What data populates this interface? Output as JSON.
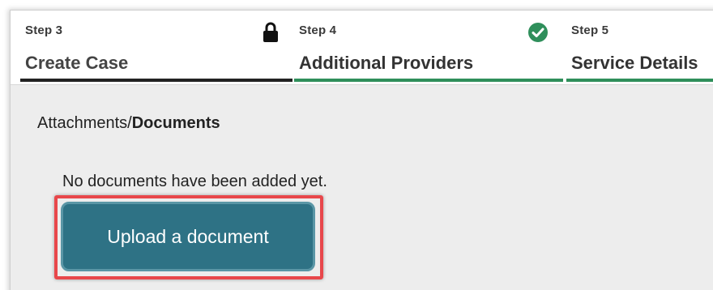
{
  "steps": [
    {
      "number": "Step 3",
      "title": "Create Case",
      "status_icon": "lock-icon"
    },
    {
      "number": "Step 4",
      "title": "Additional Providers",
      "status_icon": "check-circle-icon"
    },
    {
      "number": "Step 5",
      "title": "Service Details"
    }
  ],
  "attachments": {
    "title_prefix": "Attachments/",
    "title_bold": "Documents",
    "empty_message": "No documents have been added yet.",
    "upload_label": "Upload a document"
  },
  "colors": {
    "completed_step": "#2f8f5b",
    "current_step": "#222222",
    "upload_button": "#2e7285",
    "highlight": "#e8474b"
  }
}
